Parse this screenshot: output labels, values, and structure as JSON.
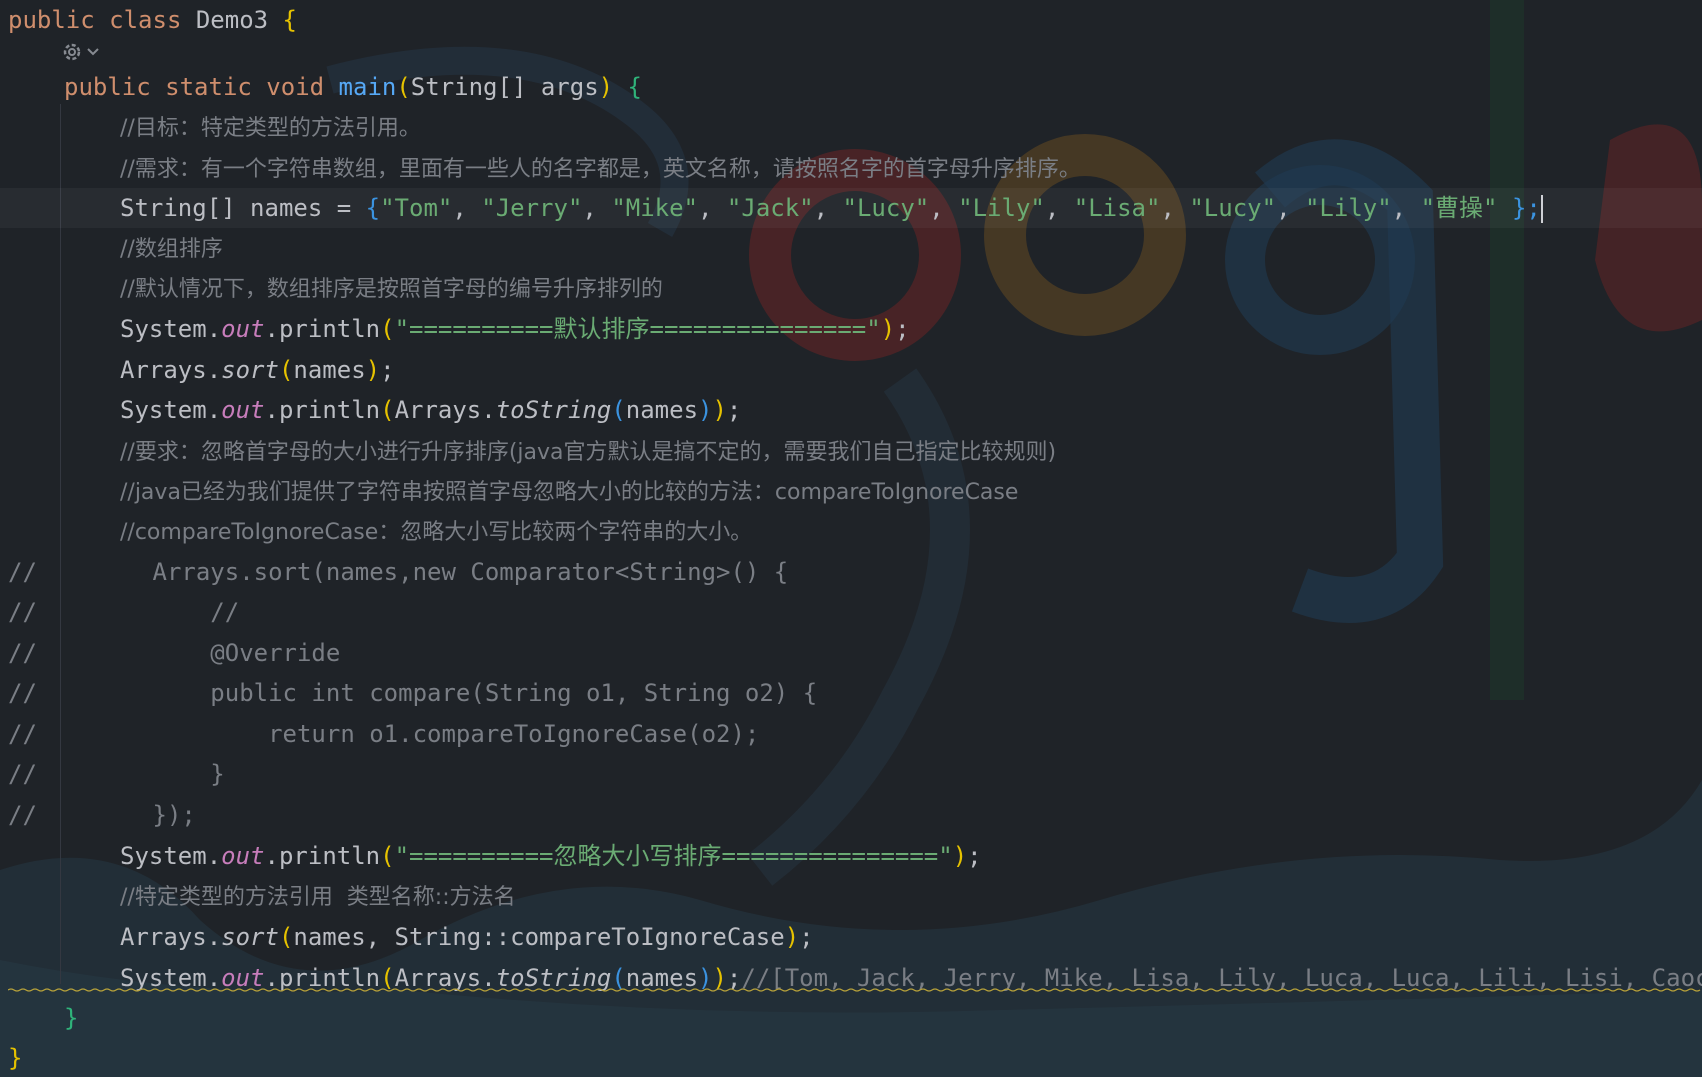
{
  "code": {
    "class_decl": {
      "kw": "public class",
      "name": "Demo3",
      "brace": "{"
    },
    "main_decl": {
      "kw1": "public static void",
      "fn": "main",
      "open": "(",
      "params": "String[] args",
      "close": ")",
      "brace": "{"
    },
    "c1": "//目标：特定类型的方法引用。",
    "c2": "//需求：有一个字符串数组，里面有一些人的名字都是，英文名称，请按照名字的首字母升序排序。",
    "names_line": {
      "type": "String[] names = ",
      "open": "{",
      "items": [
        "\"Tom\"",
        "\"Jerry\"",
        "\"Mike\"",
        "\"Jack\"",
        "\"Lucy\"",
        "\"Lily\"",
        "\"Lisa\"",
        "\"Lucy\"",
        "\"Lily\"",
        "\"曹操\""
      ],
      "close": "};"
    },
    "c3": "//数组排序",
    "c4": "//默认情况下，数组排序是按照首字母的编号升序排列的",
    "println1_str": "\"==========默认排序===============\"",
    "sort1": "names",
    "tostring1": "names",
    "c5": "//要求：忽略首字母的大小进行升序排序(java官方默认是搞不定的，需要我们自己指定比较规则)",
    "c6": "//java已经为我们提供了字符串按照首字母忽略大小的比较的方法：compareToIgnoreCase",
    "c7": "//compareToIgnoreCase：忽略大小写比较两个字符串的大小。",
    "commented": [
      "//        Arrays.sort(names,new Comparator<String>() {",
      "//            //",
      "//            @Override",
      "//            public int compare(String o1, String o2) {",
      "//                return o1.compareToIgnoreCase(o2);",
      "//            }",
      "//        });"
    ],
    "println2_str": "\"==========忽略大小写排序===============\"",
    "c8": "//特定类型的方法引用  类型名称::方法名",
    "sort2_args": "names, String::compareToIgnoreCase",
    "last_comment": "//[Tom, Jack, Jerry, Mike, Lisa, Lily, Luca, Luca, Lili, Lisi, Caocao]",
    "main_close": "}",
    "class_close": "}",
    "tokens": {
      "system": "System.",
      "out": "out",
      "println": ".println",
      "arrays": "Arrays.",
      "sort": "sort",
      "tostring": "toString",
      "semi": ";"
    }
  },
  "colors": {
    "background": "#1f2328",
    "keyword": "#cf8e6d",
    "string": "#6aab73",
    "comment": "#7a7e85",
    "function": "#56a8f5",
    "static_field": "#c77dbb"
  },
  "icons": [
    "settings-gear-icon",
    "chevron-down-icon"
  ]
}
